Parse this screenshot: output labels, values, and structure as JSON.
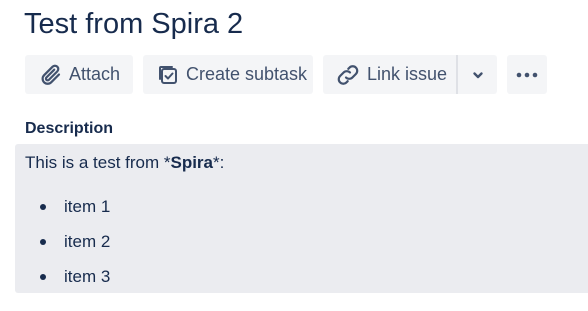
{
  "issue": {
    "title": "Test from Spira 2"
  },
  "toolbar": {
    "attach_label": "Attach",
    "create_subtask_label": "Create subtask",
    "link_issue_label": "Link issue"
  },
  "description": {
    "heading": "Description",
    "text_prefix": "This is a test from *",
    "text_bold": "Spira",
    "text_suffix": "*:",
    "items": [
      {
        "label": "item 1"
      },
      {
        "label": "item 2"
      },
      {
        "label": "item 3"
      }
    ]
  },
  "colors": {
    "text_primary": "#172b4d",
    "button_bg": "#f4f5f7",
    "button_text": "#42526e",
    "panel_bg": "#ebecf0"
  },
  "icons": {
    "attach": "paperclip-icon",
    "create_subtask": "subtask-checkbox-icon",
    "link_issue": "link-icon",
    "link_menu": "chevron-down-icon",
    "more": "more-horizontal-icon"
  }
}
